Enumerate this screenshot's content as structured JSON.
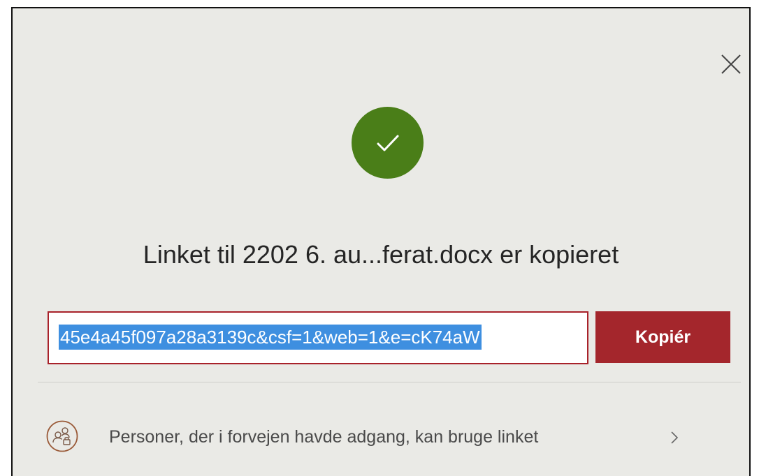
{
  "dialog": {
    "title": "Linket til 2202 6. au...ferat.docx er kopieret",
    "close_icon": "close-icon",
    "status_icon": "checkmark-icon",
    "status_color": "#4a7e18",
    "accent_color": "#a4262c"
  },
  "link": {
    "value": "45e4a45f097a28a3139c&csf=1&web=1&e=cK74aW",
    "copy_label": "Kopiér"
  },
  "access": {
    "label": "Personer, der i forvejen havde adgang, kan bruge linket",
    "icon": "people-lock-icon",
    "chevron_icon": "chevron-right-icon"
  }
}
